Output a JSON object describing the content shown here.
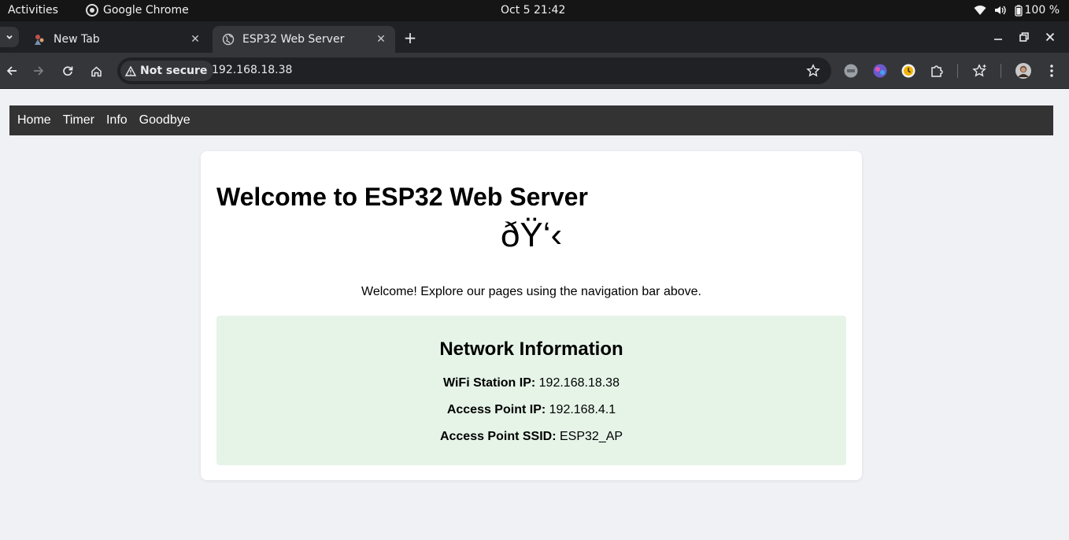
{
  "system_bar": {
    "activities": "Activities",
    "app_name": "Google Chrome",
    "clock": "Oct 5  21:42",
    "battery": "100 %"
  },
  "browser": {
    "tabs": [
      {
        "title": "New Tab",
        "active": false
      },
      {
        "title": "ESP32 Web Server",
        "active": true
      }
    ],
    "security_label": "Not secure",
    "url": "192.168.18.38"
  },
  "site": {
    "nav": [
      "Home",
      "Timer",
      "Info",
      "Goodbye"
    ],
    "heading": "Welcome to ESP32 Web Server",
    "glyph": "ðŸ‘‹",
    "intro": "Welcome! Explore our pages using the navigation bar above.",
    "network": {
      "title": "Network Information",
      "station_ip_label": "WiFi Station IP:",
      "station_ip": "192.168.18.38",
      "ap_ip_label": "Access Point IP:",
      "ap_ip": "192.168.4.1",
      "ssid_label": "Access Point SSID:",
      "ssid": "ESP32_AP"
    }
  },
  "colors": {
    "nav_bg": "#333333",
    "info_bg": "#e6f4e8",
    "page_bg": "#f0f1f5"
  }
}
